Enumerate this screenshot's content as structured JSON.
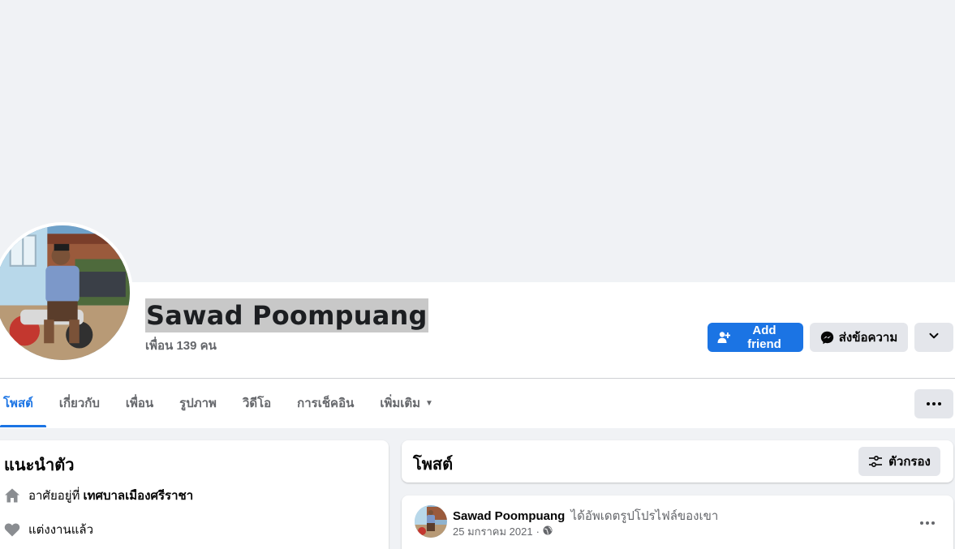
{
  "profile": {
    "name": "Sawad Poompuang",
    "friends": "เพื่อน 139 คน"
  },
  "actions": {
    "add_friend": "Add friend",
    "message": "ส่งข้อความ"
  },
  "tabs": [
    {
      "label": "โพสต์",
      "active": true
    },
    {
      "label": "เกี่ยวกับ"
    },
    {
      "label": "เพื่อน"
    },
    {
      "label": "รูปภาพ"
    },
    {
      "label": "วิดีโอ"
    },
    {
      "label": "การเช็คอิน"
    },
    {
      "label": "เพิ่มเติม"
    }
  ],
  "intro": {
    "title": "แนะนำตัว",
    "lives_prefix": "อาศัยอยู่ที่",
    "lives_place": "เทศบาลเมืองศรีราชา",
    "relationship": "แต่งงานแล้ว"
  },
  "posts": {
    "title": "โพสต์",
    "filter_label": "ตัวกรอง"
  },
  "post": {
    "author": "Sawad Poompuang",
    "action": "ได้อัพเดตรูปโปรไฟล์ของเขา",
    "date": "25 มกราคม 2021",
    "separator": "·"
  },
  "colors": {
    "accent": "#1b74e4",
    "background": "#f0f2f5",
    "secondary_button": "#e4e6eb",
    "muted_text": "#65676b"
  },
  "icons": {
    "add_friend": "user-plus-icon",
    "message": "messenger-icon",
    "more_options": "chevron-down-icon",
    "tab_more": "caret-down-icon",
    "home": "home-icon",
    "heart": "heart-icon",
    "filter": "filter-icon",
    "globe": "globe-icon",
    "ellipsis": "ellipsis-icon"
  }
}
